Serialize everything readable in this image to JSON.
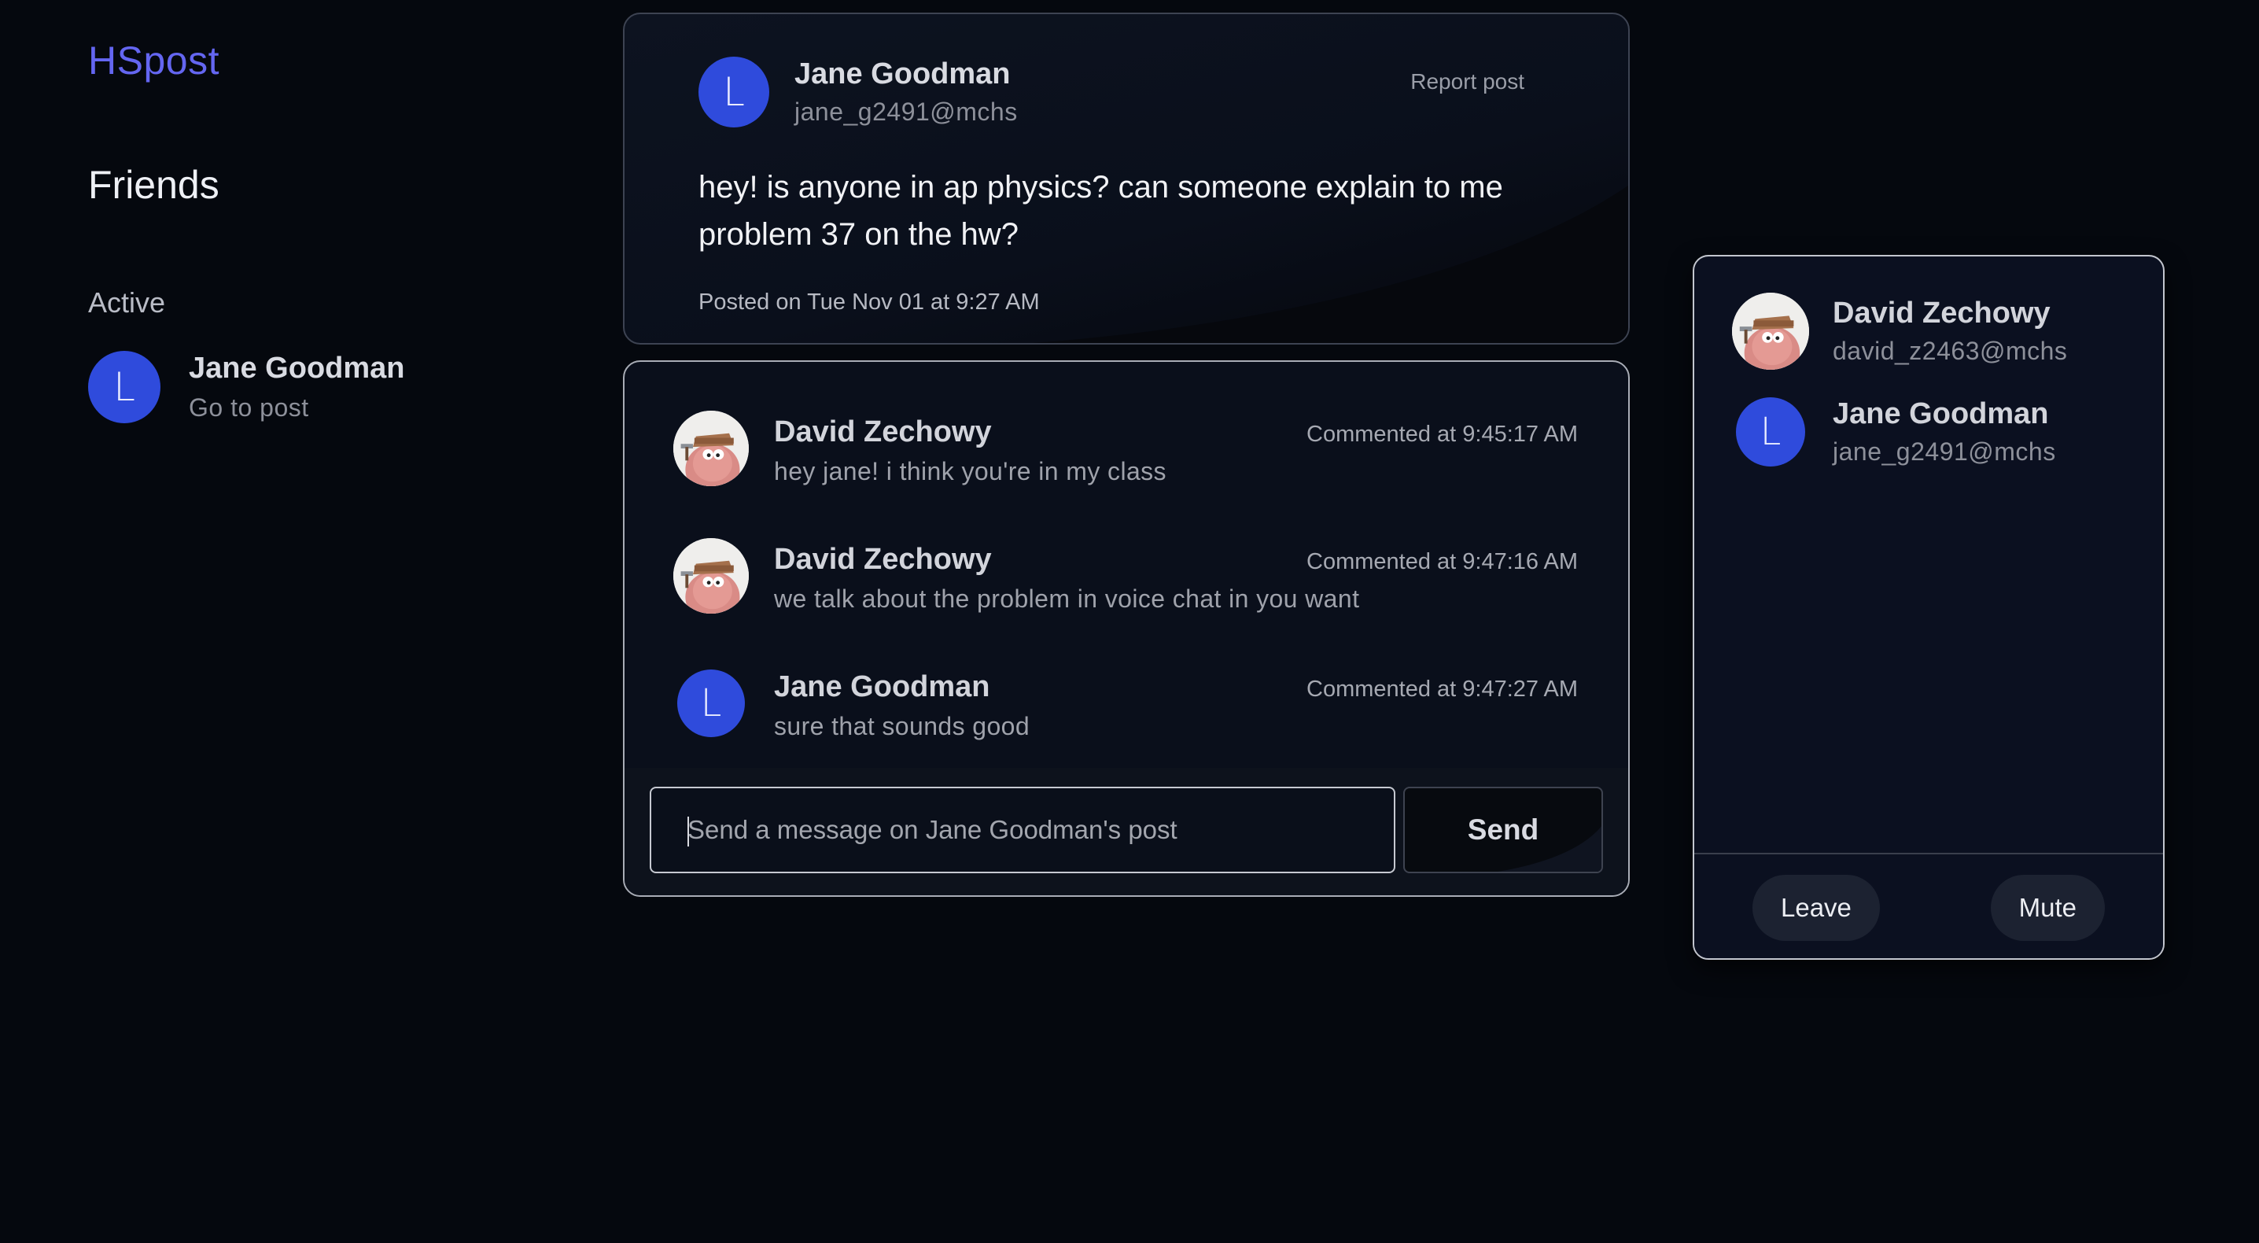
{
  "app": {
    "brand": "HSpost"
  },
  "sidebar": {
    "title": "Friends",
    "section_label": "Active",
    "friends": [
      {
        "avatar_letter": "L",
        "name": "Jane Goodman",
        "action": "Go to post"
      }
    ]
  },
  "post": {
    "author": {
      "avatar_letter": "L",
      "name": "Jane Goodman",
      "handle": "jane_g2491@mchs"
    },
    "report_label": "Report post",
    "body": "hey! is anyone in ap physics? can someone explain to me problem 37 on the hw?",
    "posted_at": "Posted on Tue Nov 01 at 9:27 AM"
  },
  "comments": [
    {
      "avatar": "patrick-avatar",
      "name": "David Zechowy",
      "message": "hey jane! i think you're in my class",
      "time": "Commented at 9:45:17 AM"
    },
    {
      "avatar": "patrick-avatar",
      "name": "David Zechowy",
      "message": "we talk about the problem in voice chat in you want",
      "time": "Commented at 9:47:16 AM"
    },
    {
      "avatar_letter": "L",
      "name": "Jane Goodman",
      "message": "sure that sounds good",
      "time": "Commented at 9:47:27 AM"
    }
  ],
  "compose": {
    "placeholder": "Send a message on Jane Goodman's post",
    "send_label": "Send"
  },
  "members_panel": {
    "members": [
      {
        "avatar": "patrick-avatar",
        "name": "David Zechowy",
        "handle": "david_z2463@mchs"
      },
      {
        "avatar_letter": "L",
        "name": "Jane Goodman",
        "handle": "jane_g2491@mchs"
      }
    ],
    "leave_label": "Leave",
    "mute_label": "Mute"
  },
  "colors": {
    "brand": "#6466f1",
    "avatar_blue": "#2f4bdc",
    "background": "#05080e",
    "card": "#0a0f1b"
  }
}
